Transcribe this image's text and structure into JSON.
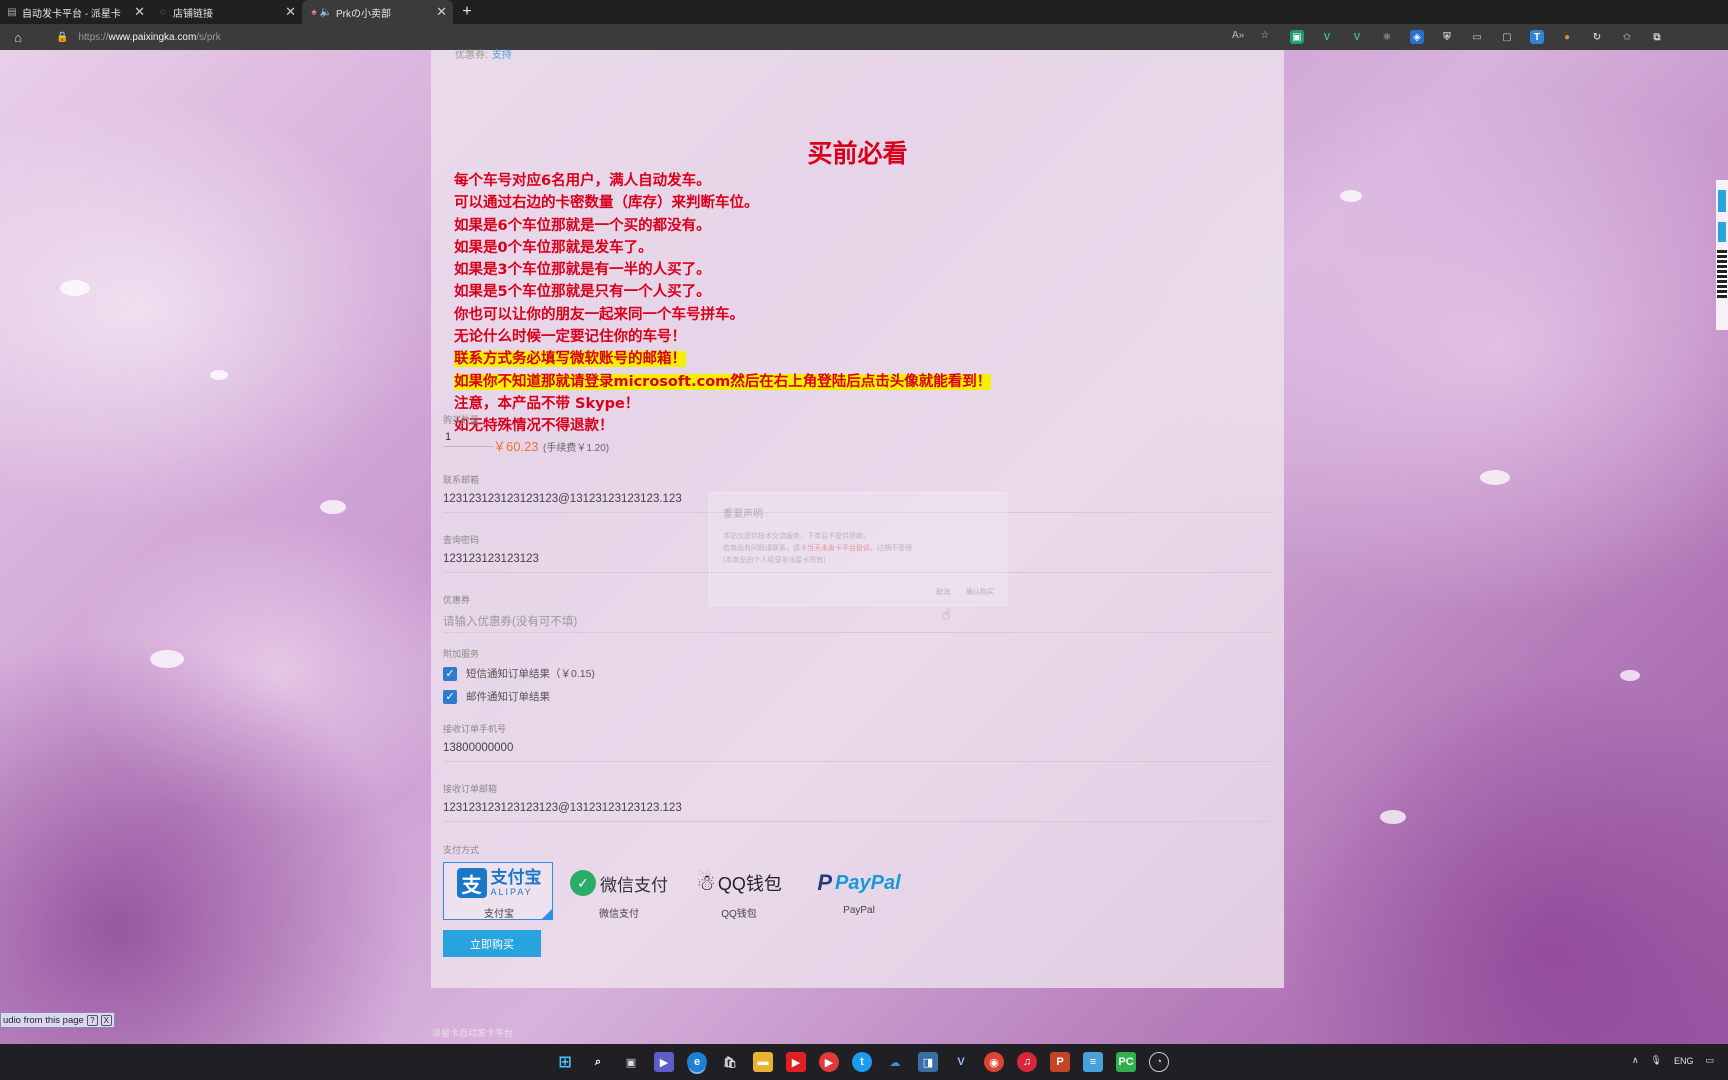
{
  "browser": {
    "tabs": [
      {
        "title": "自动发卡平台 - 派星卡",
        "icon": "page-icon",
        "active": false
      },
      {
        "title": "店铺链接",
        "icon": "loading-icon",
        "active": false
      },
      {
        "title": "Prkの小卖部",
        "icon": "store-icon",
        "active": true
      }
    ],
    "new_tab_label": "+",
    "url_scheme": "https://",
    "url_host": "www.paixingka.com",
    "url_path": "/s/prk"
  },
  "page": {
    "coupon_top_label": "优惠券:",
    "coupon_top_link": "支持",
    "must_read_title": "买前必看",
    "notices": [
      {
        "text": "每个车号对应6名用户，满人自动发车。",
        "highlight": false
      },
      {
        "text": "可以通过右边的卡密数量（库存）来判断车位。",
        "highlight": false
      },
      {
        "text": "如果是6个车位那就是一个买的都没有。",
        "highlight": false
      },
      {
        "text": "如果是0个车位那就是发车了。",
        "highlight": false
      },
      {
        "text": "如果是3个车位那就是有一半的人买了。",
        "highlight": false
      },
      {
        "text": "如果是5个车位那就是只有一个人买了。",
        "highlight": false
      },
      {
        "text": "你也可以让你的朋友一起来同一个车号拼车。",
        "highlight": false
      },
      {
        "text": "无论什么时候一定要记住你的车号！",
        "highlight": false
      },
      {
        "text": "联系方式务必填写微软账号的邮箱！",
        "highlight": true
      },
      {
        "text": "如果你不知道那就请登录microsoft.com然后在右上角登陆后点击头像就能看到！",
        "highlight": true
      },
      {
        "text": "注意，本产品不带 Skype！",
        "highlight": false
      },
      {
        "text": "如无特殊情况不得退款！",
        "highlight": false
      }
    ],
    "quantity": {
      "label": "购买数量",
      "value": "1",
      "price": "￥60.23",
      "fee": "(手续费￥1.20)"
    },
    "contact_email": {
      "label": "联系邮箱",
      "value": "123123123123123123@13123123123123.123"
    },
    "query_password": {
      "label": "查询密码",
      "value": "123123123123123"
    },
    "coupon": {
      "label": "优惠券",
      "placeholder": "请输入优惠券(没有可不填)"
    },
    "extra_services": {
      "label": "附加服务",
      "sms": {
        "label": "短信通知订单结果（￥0.15)",
        "checked": true
      },
      "email": {
        "label": "邮件通知订单结果",
        "checked": true
      }
    },
    "receive_phone": {
      "label": "接收订单手机号",
      "value": "13800000000"
    },
    "receive_email": {
      "label": "接收订单邮箱",
      "value": "123123123123123123@13123123123123.123"
    },
    "payment": {
      "label": "支付方式",
      "options": [
        {
          "logo_text": "支付宝",
          "logo_sub": "ALIPAY",
          "name": "支付宝",
          "selected": true
        },
        {
          "logo_text": "微信支付",
          "name": "微信支付",
          "selected": false
        },
        {
          "logo_text": "QQ钱包",
          "name": "QQ钱包",
          "selected": false
        },
        {
          "logo_text": "PayPal",
          "name": "PayPal",
          "selected": false
        }
      ]
    },
    "buy_button": "立即购买",
    "modal": {
      "title": "重要声明",
      "line1": "本站仅提供技术交流服务，下单后不提供退款。",
      "line2_prefix": "若商品有问题请联系，请卡",
      "line2_red": "当天未发卡平台投诉",
      "line2_suffix": "，过期不受理",
      "line3": "(本商品由个人经营非派星卡所有)",
      "btn_cancel": "取消",
      "btn_ok": "确认购买"
    },
    "footer": "派星卡自动发卡平台"
  },
  "audio_bar": {
    "text": "udio from this page",
    "help": "?",
    "close": "X"
  },
  "taskbar": {
    "lang": "ENG"
  },
  "colors": {
    "notice_red": "#d9001b",
    "highlight": "#f5f000",
    "button_blue": "#29a3dd",
    "price_orange": "#e8762c"
  }
}
